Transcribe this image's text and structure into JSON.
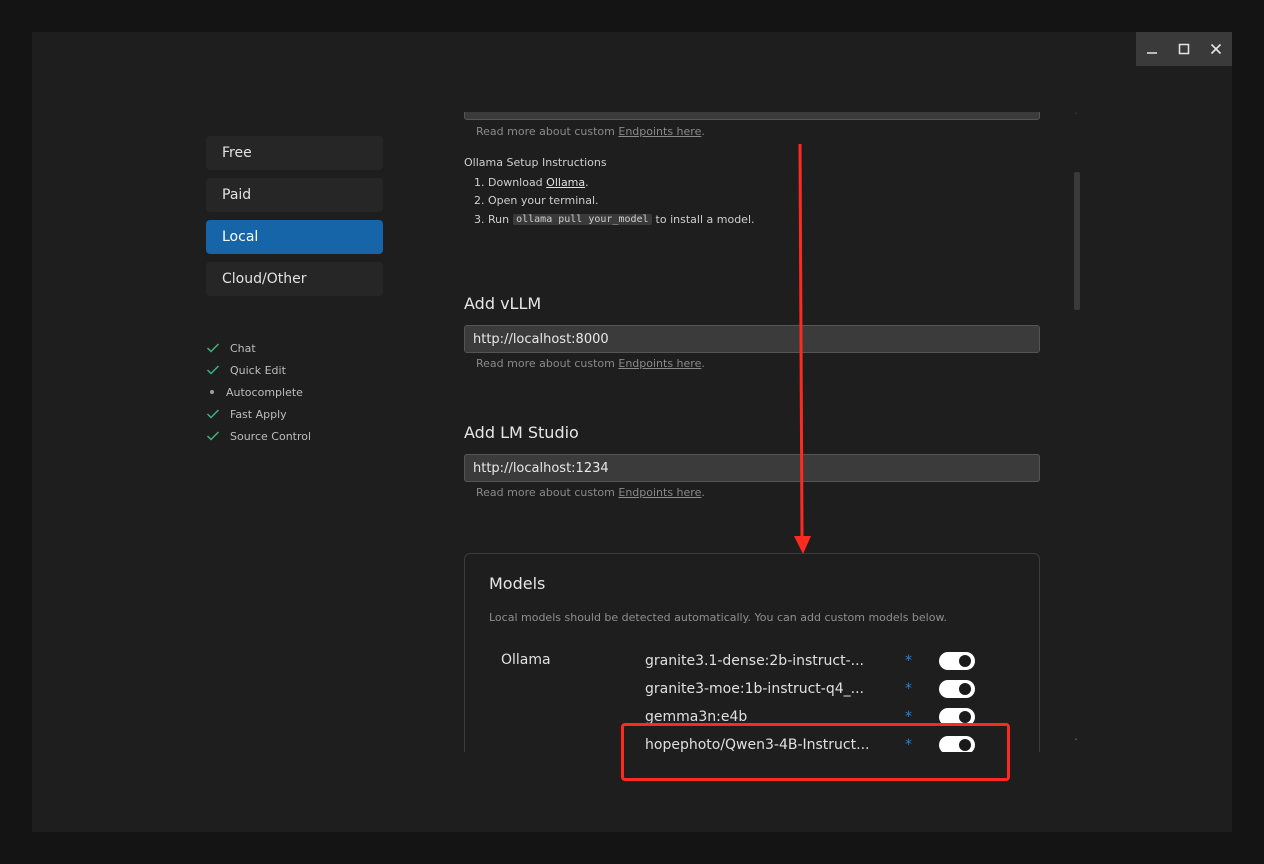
{
  "window": {
    "controls": {
      "minimize_icon": "minimize-icon",
      "maximize_icon": "maximize-icon",
      "close_icon": "close-icon"
    }
  },
  "sidebar": {
    "tabs": [
      {
        "label": "Free"
      },
      {
        "label": "Paid"
      },
      {
        "label": "Local",
        "active": true
      },
      {
        "label": "Cloud/Other"
      }
    ],
    "features": [
      {
        "label": "Chat",
        "status": "check"
      },
      {
        "label": "Quick Edit",
        "status": "check"
      },
      {
        "label": "Autocomplete",
        "status": "dot"
      },
      {
        "label": "Fast Apply",
        "status": "check"
      },
      {
        "label": "Source Control",
        "status": "check"
      }
    ]
  },
  "ollama": {
    "hint_prefix": "Read more about custom ",
    "hint_link": "Endpoints here",
    "hint_suffix": ".",
    "setup_title": "Ollama Setup Instructions",
    "step1_prefix": "1. Download ",
    "step1_link": "Ollama",
    "step1_suffix": ".",
    "step2": "2. Open your terminal.",
    "step3_prefix": "3. Run ",
    "step3_code": "ollama pull your_model",
    "step3_suffix": "to install a model."
  },
  "vllm": {
    "title": "Add vLLM",
    "endpoint": "http://localhost:8000",
    "hint_prefix": "Read more about custom ",
    "hint_link": "Endpoints here",
    "hint_suffix": "."
  },
  "lmstudio": {
    "title": "Add LM Studio",
    "endpoint": "http://localhost:1234",
    "hint_prefix": "Read more about custom ",
    "hint_link": "Endpoints here",
    "hint_suffix": "."
  },
  "models": {
    "title": "Models",
    "description": "Local models should be detected automatically. You can add custom models below.",
    "provider": "Ollama",
    "list": [
      {
        "name": "granite3.1-dense:2b-instruct-...",
        "marker": "*",
        "enabled": true
      },
      {
        "name": "granite3-moe:1b-instruct-q4_...",
        "marker": "*",
        "enabled": true
      },
      {
        "name": "gemma3n:e4b",
        "marker": "*",
        "enabled": true
      },
      {
        "name": "hopephoto/Qwen3-4B-Instruct...",
        "marker": "*",
        "enabled": true
      }
    ]
  },
  "colors": {
    "accent": "#1565a8",
    "annotation": "#ff2a1f",
    "star": "#2a82d6"
  }
}
